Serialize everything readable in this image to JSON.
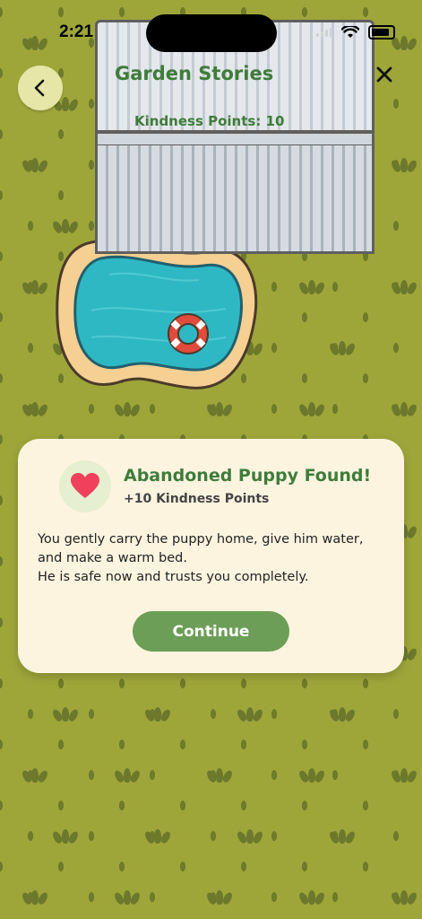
{
  "status_bar": {
    "time": "2:21"
  },
  "header": {
    "title": "Garden Stories",
    "kindness_label": "Kindness Points: 10"
  },
  "icons": {
    "back": "chevron-left-icon",
    "close": "close-icon",
    "heart": "heart-icon"
  },
  "dialog": {
    "title": "Abandoned Puppy Found!",
    "subtitle": "+10 Kindness Points",
    "body_line1": "You gently carry the puppy home, give him water, and make a warm bed.",
    "body_line2": "He is safe now and trusts you completely.",
    "continue_label": "Continue"
  },
  "colors": {
    "background": "#9ea63a",
    "accent_green": "#3f7c3a",
    "button_green": "#6d9e57",
    "dialog_bg": "#fdf4e0",
    "heart": "#f0405c"
  }
}
